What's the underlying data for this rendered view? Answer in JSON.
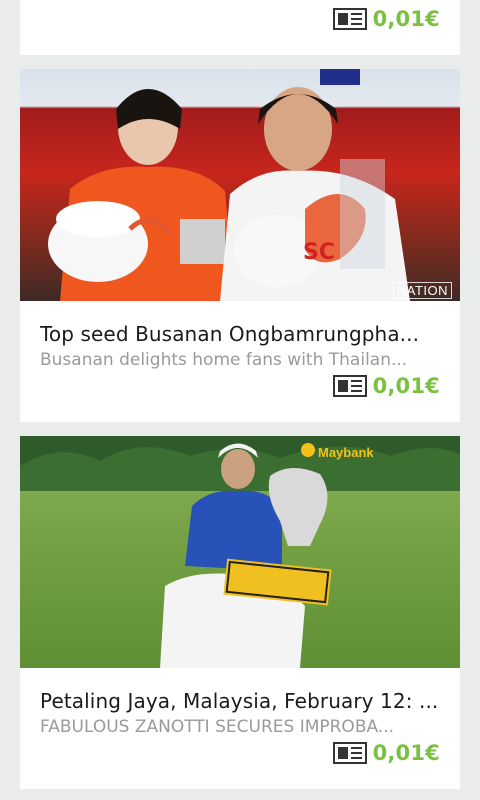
{
  "feed": {
    "top_card": {
      "price": "0,01€",
      "icon": "newspaper-icon"
    },
    "items": [
      {
        "title": "Top seed Busanan Ongbamrungpha...",
        "subtitle": "Busanan delights home fans with Thailan...",
        "price": "0,01€",
        "image_watermark": "NATION",
        "icon": "newspaper-icon"
      },
      {
        "title": "Petaling Jaya, Malaysia, February 12: ...",
        "subtitle": "FABULOUS ZANOTTI SECURES IMPROBA...",
        "price": "0,01€",
        "image_brand": "Maybank",
        "icon": "newspaper-icon"
      }
    ]
  },
  "colors": {
    "background": "#e9ecea",
    "card": "#ffffff",
    "price": "#7ac142",
    "title": "#1b1b1b",
    "subtitle": "#9a9a9a"
  }
}
